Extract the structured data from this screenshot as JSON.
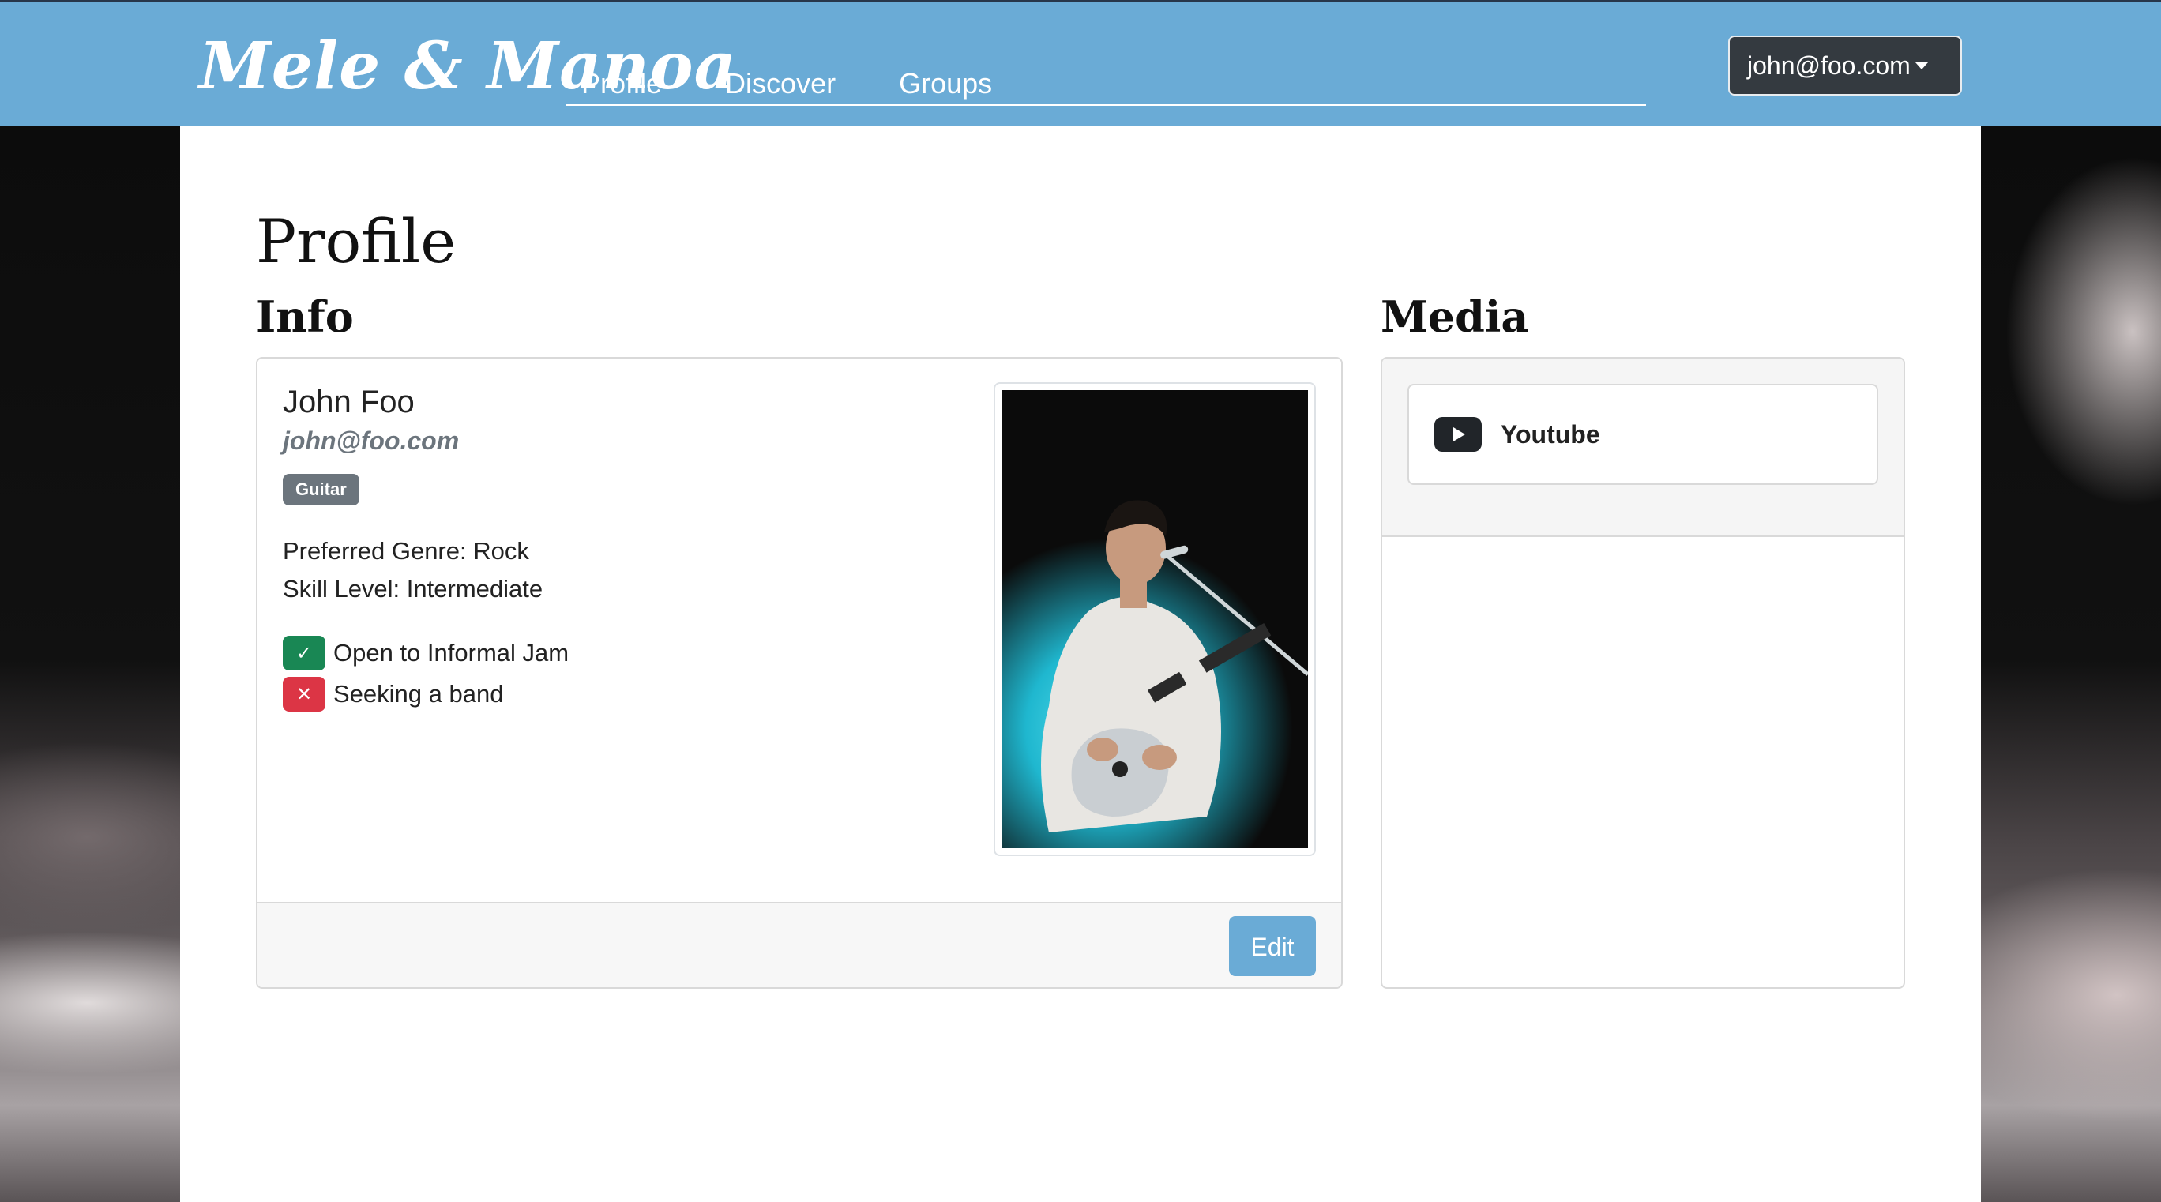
{
  "navbar": {
    "brand": "Mele & Manoa",
    "links": [
      "Profile",
      "Discover",
      "Groups"
    ],
    "user_menu_label": "john@foo.com"
  },
  "page": {
    "title": "Profile"
  },
  "info": {
    "section_title": "Info",
    "name": "John Foo",
    "email": "john@foo.com",
    "instrument_badge": "Guitar",
    "preferred_genre": "Preferred Genre: Rock",
    "skill_level": "Skill Level: Intermediate",
    "open_to_jam": {
      "label": "Open to Informal Jam",
      "value": true,
      "icon": "check-icon"
    },
    "seeking_band": {
      "label": "Seeking a band",
      "value": false,
      "icon": "x-icon"
    },
    "photo_alt": "profile photo",
    "edit_label": "Edit"
  },
  "media": {
    "section_title": "Media",
    "tabs": [
      {
        "label": "Youtube",
        "icon": "youtube-icon"
      }
    ]
  },
  "colors": {
    "navbar": "#6aabd6",
    "user_button": "#343a40",
    "edit_button": "#6aabd6",
    "badge": "#6c757d",
    "yes": "#198754",
    "no": "#dc3545"
  }
}
